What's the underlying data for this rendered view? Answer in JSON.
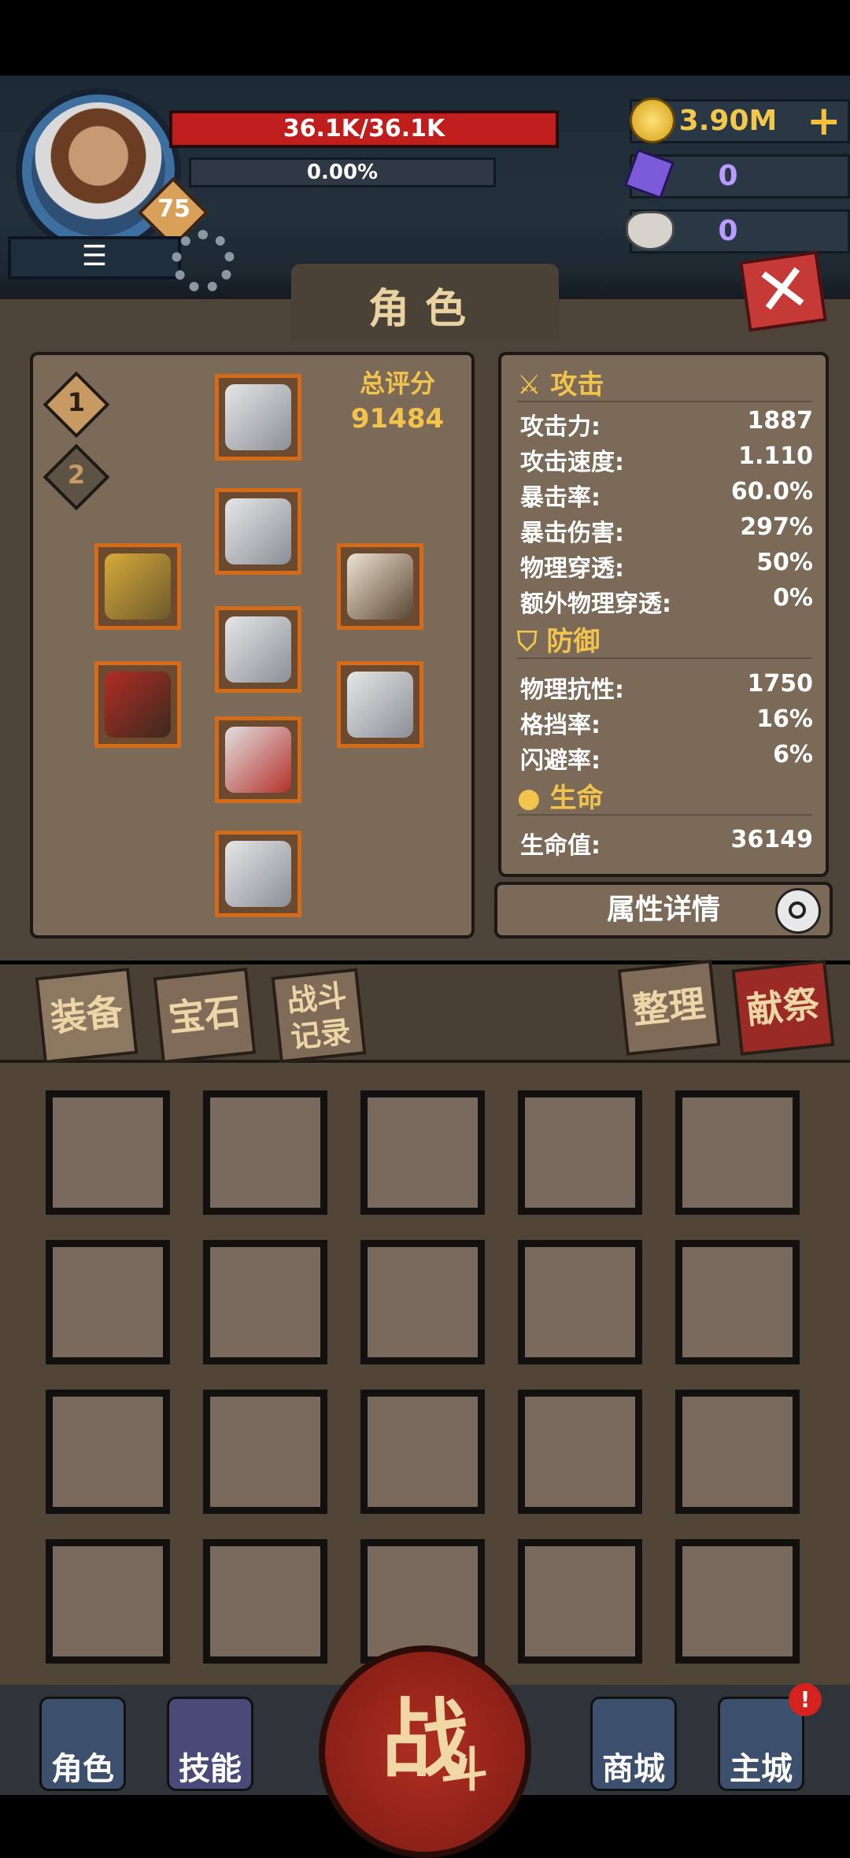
{
  "hud": {
    "level": "75",
    "hp": "36.1K/36.1K",
    "xp": "0.00%",
    "menu_glyph": "☰",
    "resources": [
      {
        "icon": "gold-coin-icon",
        "value": "3.90M",
        "color": "#f3c74b"
      },
      {
        "icon": "purple-crystal-icon",
        "value": "0",
        "color": "#b89cff"
      },
      {
        "icon": "ram-skull-icon",
        "value": "0",
        "color": "#b89cff"
      }
    ],
    "add_glyph": "+",
    "close_glyph": "✕"
  },
  "title": "角色",
  "equipment": {
    "score_label": "总评分",
    "score_value": "91484",
    "presets": [
      "1",
      "2"
    ],
    "slots": [
      "helmet",
      "chest-armor",
      "bracelet",
      "necklace",
      "belt",
      "weapon-axe",
      "gauntlets",
      "leg-armor",
      "boots"
    ]
  },
  "stats": {
    "attack_header": "攻击",
    "attack": [
      {
        "label": "攻击力:",
        "value": "1887"
      },
      {
        "label": "攻击速度:",
        "value": "1.110"
      },
      {
        "label": "暴击率:",
        "value": "60.0%"
      },
      {
        "label": "暴击伤害:",
        "value": "297%"
      },
      {
        "label": "物理穿透:",
        "value": "50%"
      },
      {
        "label": "额外物理穿透:",
        "value": "0%"
      }
    ],
    "defense_header": "防御",
    "defense": [
      {
        "label": "物理抗性:",
        "value": "1750"
      },
      {
        "label": "格挡率:",
        "value": "16%"
      },
      {
        "label": "闪避率:",
        "value": "6%"
      }
    ],
    "life_header": "生命",
    "life": [
      {
        "label": "生命值:",
        "value": "36149"
      }
    ],
    "detail_button": "属性详情"
  },
  "tabs": {
    "equipment": "装备",
    "gems": "宝石",
    "battle_log": "战斗记录",
    "sort": "整理",
    "sacrifice": "献祭"
  },
  "nav": {
    "character": "角色",
    "skills": "技能",
    "battle": "战",
    "battle_sub": "斗",
    "shop": "商城",
    "city": "主城",
    "city_alert": "!"
  }
}
